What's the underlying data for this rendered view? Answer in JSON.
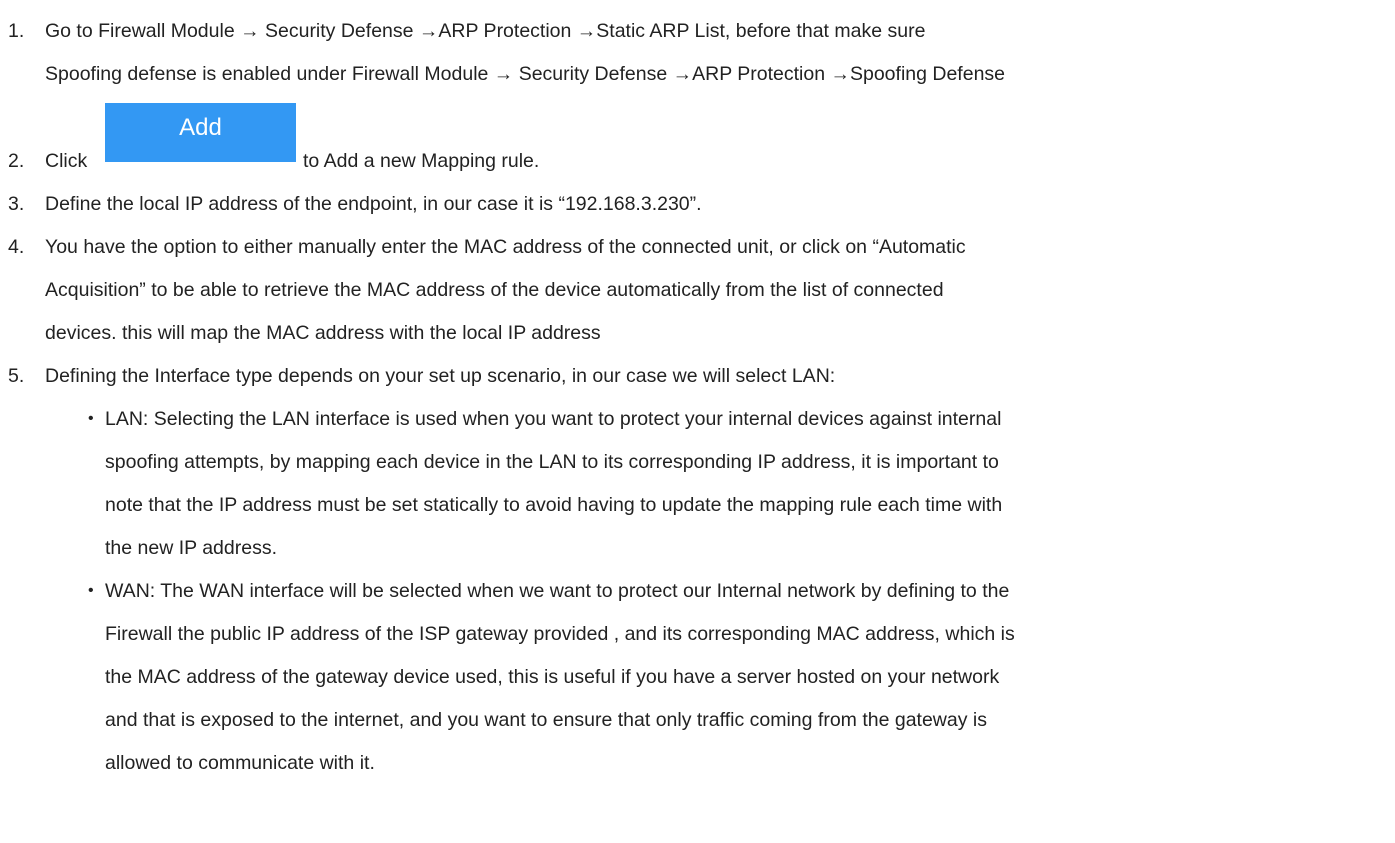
{
  "steps": [
    {
      "number": "1.",
      "lines": [
        "Go to Firewall Module → Security Defense →ARP Protection →Static ARP List, before that make sure",
        "Spoofing defense is enabled under Firewall Module → Security Defense →ARP Protection →Spoofing Defense"
      ]
    },
    {
      "number": "2.",
      "before": "Click",
      "button_label": "Add",
      "after": "to Add a new Mapping rule."
    },
    {
      "number": "3.",
      "lines": [
        "Define the local IP address of the endpoint, in our case it is “192.168.3.230”."
      ]
    },
    {
      "number": "4.",
      "lines": [
        "You have the option to either manually enter the MAC address of the connected unit, or click on “Automatic",
        "Acquisition” to be able to retrieve the MAC address of the device automatically from the list of connected",
        "devices. this will map the MAC address with the local IP address"
      ]
    },
    {
      "number": "5.",
      "lines": [
        "Defining the Interface type depends on your set up scenario, in our case we will select LAN:"
      ]
    }
  ],
  "bullets": [
    {
      "lines": [
        "LAN: Selecting the LAN interface is used when you want to protect your internal devices against internal",
        "spoofing attempts, by mapping each device in the LAN to its corresponding IP address, it is important to",
        "note that the IP address must be set statically to avoid having to update the mapping rule each time with",
        "the new IP address."
      ]
    },
    {
      "lines": [
        "WAN: The WAN interface will be selected when we want to protect our Internal network by defining to the",
        "Firewall the public IP address of the ISP gateway provided , and its corresponding MAC address, which is",
        "the MAC address of the gateway device used, this is useful if you have a server hosted on your network",
        "and that is exposed to the internet, and you want to ensure that only traffic coming from the gateway is",
        "allowed to communicate with it."
      ]
    }
  ],
  "bullet_glyph": "•"
}
